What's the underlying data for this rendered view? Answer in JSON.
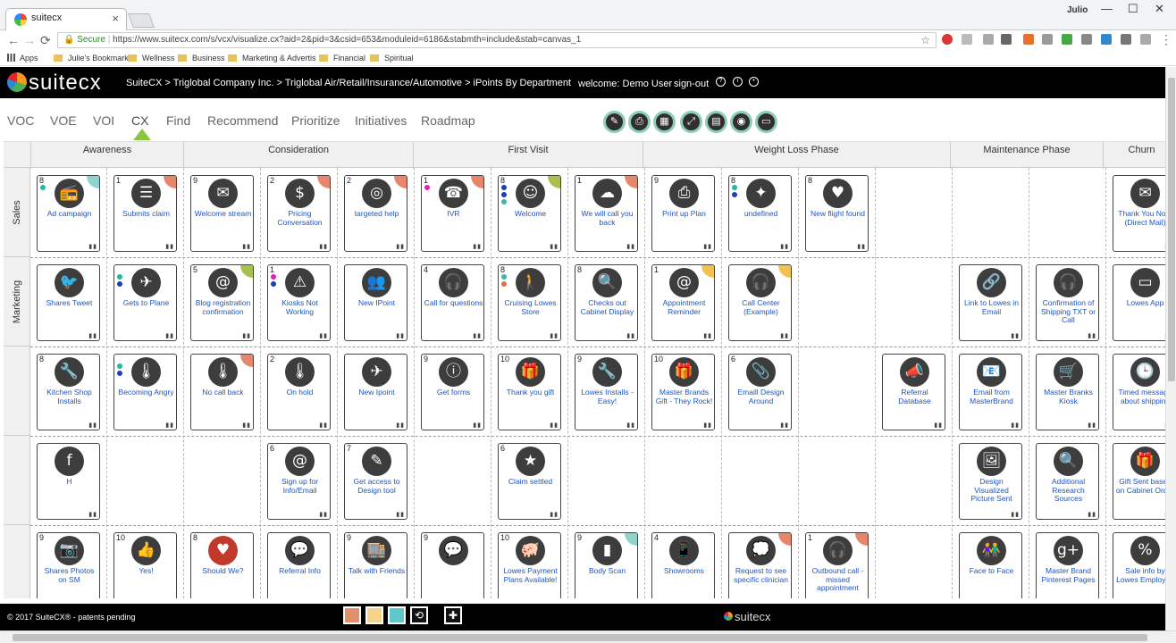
{
  "browser": {
    "tab_title": "suitecx",
    "user": "Julio",
    "address": {
      "secure": "Secure",
      "url": "https://www.suitecx.com/s/vcx/visualize.cx?aid=2&pid=3&csid=653&moduleid=6186&stabmth=include&stab=canvas_1"
    },
    "bookmarks": [
      "Apps",
      "Julie's Bookmarks",
      "Wellness",
      "Business",
      "Marketing & Advertis",
      "Financial",
      "Spiritual"
    ]
  },
  "app": {
    "logo": "suitecx",
    "breadcrumb": "SuiteCX > Triglobal Company Inc. > Triglobal Air/Retail/Insurance/Automotive > iPoints By Department",
    "welcome": "welcome: Demo User",
    "signout": "sign-out"
  },
  "nav": [
    "VOC",
    "VOE",
    "VOI",
    "CX",
    "Find",
    "Recommend",
    "Prioritize",
    "Initiatives",
    "Roadmap"
  ],
  "active_nav": "CX",
  "phases": [
    "Awareness",
    "Consideration",
    "First Visit",
    "Weight Loss Phase",
    "Maintenance Phase",
    "Churn"
  ],
  "rows": [
    "Sales",
    "Marketing",
    "",
    "",
    ""
  ],
  "cards": [
    {
      "num": "8",
      "label": "Ad campaign",
      "icon": "radio-icon",
      "corner": "#8fd3cf",
      "dots": [
        "#22b8a8"
      ],
      "row": 0,
      "col": 0
    },
    {
      "num": "1",
      "label": "Submits claim",
      "icon": "document-icon",
      "corner": "#e8866b",
      "row": 0,
      "col": 1
    },
    {
      "num": "9",
      "label": "Welcome stream",
      "icon": "envelope-open-icon",
      "row": 0,
      "col": 2
    },
    {
      "num": "2",
      "label": "Pricing Conversation",
      "icon": "money-icon",
      "corner": "#e8866b",
      "row": 0,
      "col": 3
    },
    {
      "num": "2",
      "label": "targeted help",
      "icon": "target-icon",
      "corner": "#e8866b",
      "row": 0,
      "col": 4
    },
    {
      "num": "1",
      "label": "IVR",
      "icon": "phone-cycle-icon",
      "corner": "#e8866b",
      "dots": [
        "#e020c0"
      ],
      "row": 0,
      "col": 5
    },
    {
      "num": "8",
      "label": "Welcome",
      "icon": "smiley-icon",
      "corner": "#a8c14c",
      "dots": [
        "#1d3fb8",
        "#1d3fb8",
        "#3db8a8"
      ],
      "row": 0,
      "col": 6
    },
    {
      "num": "1",
      "label": "We will call you back",
      "icon": "cloud-icon",
      "corner": "#e8866b",
      "row": 0,
      "col": 7
    },
    {
      "num": "9",
      "label": "Print up Plan",
      "icon": "pdf-icon",
      "row": 0,
      "col": 8
    },
    {
      "num": "8",
      "label": "undefined",
      "icon": "idea-icon",
      "dots": [
        "#22b8a8",
        "#1d3fb8"
      ],
      "row": 0,
      "col": 9
    },
    {
      "num": "8",
      "label": "New flight found",
      "icon": "heart-icon",
      "row": 0,
      "col": 10
    },
    {
      "num": "",
      "label": "Thank You Note (Direct Mail)",
      "icon": "mail-icon",
      "row": 0,
      "col": 14
    },
    {
      "num": "",
      "label": "Shares Tweet",
      "icon": "twitter-icon",
      "row": 1,
      "col": 0
    },
    {
      "num": "",
      "label": "Gets to Plane",
      "icon": "plane-icon",
      "dots": [
        "#22b8a8",
        "#1d3fb8"
      ],
      "row": 1,
      "col": 1
    },
    {
      "num": "5",
      "label": "Blog registration confirmation",
      "icon": "at-icon",
      "corner": "#a8c14c",
      "row": 1,
      "col": 2
    },
    {
      "num": "1",
      "label": "Kiosks Not Working",
      "icon": "warning-icon",
      "dots": [
        "#e020c0",
        "#1d3fb8"
      ],
      "row": 1,
      "col": 3
    },
    {
      "num": "",
      "label": "New IPoint",
      "icon": "people-icon",
      "row": 1,
      "col": 4
    },
    {
      "num": "4",
      "label": "Call for questions",
      "icon": "headset-icon",
      "row": 1,
      "col": 5
    },
    {
      "num": "8",
      "label": "Cruising Lowes Store",
      "icon": "walking-icon",
      "dots": [
        "#3db8a8",
        "#e86a4a"
      ],
      "row": 1,
      "col": 6
    },
    {
      "num": "8",
      "label": "Checks out Cabinet Display",
      "icon": "magnifier-icon",
      "row": 1,
      "col": 7
    },
    {
      "num": "1",
      "label": "Appointment Reminder",
      "icon": "at-icon",
      "corner": "#f2c14e",
      "row": 1,
      "col": 8
    },
    {
      "num": "",
      "label": "Call Center (Example)",
      "icon": "headset-icon",
      "corner": "#f2c14e",
      "row": 1,
      "col": 9
    },
    {
      "num": "",
      "label": "Link to Lowes in Email",
      "icon": "link-icon",
      "row": 1,
      "col": 12
    },
    {
      "num": "",
      "label": "Confirmation of Shipping TXT or Call",
      "icon": "headset-icon",
      "row": 1,
      "col": 13
    },
    {
      "num": "",
      "label": "Lowes App",
      "icon": "browser-icon",
      "row": 1,
      "col": 14
    },
    {
      "num": "8",
      "label": "Kitchen Shop Installs",
      "icon": "tools-icon",
      "row": 2,
      "col": 0
    },
    {
      "num": "",
      "label": "Becoming Angry",
      "icon": "thermometer-icon",
      "dots": [
        "#22b8a8",
        "#1d3fb8"
      ],
      "row": 2,
      "col": 1
    },
    {
      "num": "",
      "label": "No call back",
      "icon": "thermometer-icon",
      "corner": "#e8866b",
      "row": 2,
      "col": 2
    },
    {
      "num": "2",
      "label": "On hold",
      "icon": "thermometer-icon",
      "row": 2,
      "col": 3
    },
    {
      "num": "",
      "label": "New Ipoint",
      "icon": "plane-icon",
      "row": 2,
      "col": 4
    },
    {
      "num": "9",
      "label": "Get forms",
      "icon": "info-icon",
      "row": 2,
      "col": 5
    },
    {
      "num": "10",
      "label": "Thank you gift",
      "icon": "gift-icon",
      "row": 2,
      "col": 6
    },
    {
      "num": "9",
      "label": "Lowes Installs - Easy!",
      "icon": "tools-icon",
      "row": 2,
      "col": 7
    },
    {
      "num": "10",
      "label": "Master Brands Gift - They Rock!",
      "icon": "gift-icon",
      "row": 2,
      "col": 8
    },
    {
      "num": "6",
      "label": "Emaill Design Around",
      "icon": "paperclip-icon",
      "row": 2,
      "col": 9
    },
    {
      "num": "",
      "label": "Referral Database",
      "icon": "megaphone-icon",
      "row": 2,
      "col": 11
    },
    {
      "num": "",
      "label": "Email from MasterBrand",
      "icon": "email-doc-icon",
      "row": 2,
      "col": 12
    },
    {
      "num": "",
      "label": "Master Branks Kiosk",
      "icon": "cart-icon",
      "row": 2,
      "col": 13
    },
    {
      "num": "",
      "label": "Timed message about shipping",
      "icon": "clock-icon",
      "row": 2,
      "col": 14
    },
    {
      "num": "",
      "label": "H",
      "icon": "facebook-icon",
      "row": 3,
      "col": 0
    },
    {
      "num": "6",
      "label": "Sign up for Info/Email",
      "icon": "at-icon",
      "row": 3,
      "col": 3
    },
    {
      "num": "7",
      "label": "Get access to Design tool",
      "icon": "design-tools-icon",
      "row": 3,
      "col": 4
    },
    {
      "num": "6",
      "label": "Claim settled",
      "icon": "star-icon",
      "row": 3,
      "col": 6
    },
    {
      "num": "",
      "label": "Design Visualized Picture Sent",
      "icon": "picture-icon",
      "row": 3,
      "col": 12
    },
    {
      "num": "",
      "label": "Additional Research Sources",
      "icon": "magnifier-icon",
      "row": 3,
      "col": 13
    },
    {
      "num": "",
      "label": "Gift Sent based on Cabinet Order",
      "icon": "gift-icon",
      "row": 3,
      "col": 14
    },
    {
      "num": "9",
      "label": "Shares Photos on SM",
      "icon": "photo-icon",
      "row": 4,
      "col": 0
    },
    {
      "num": "10",
      "label": "Yes!",
      "icon": "thumbs-up-icon",
      "row": 4,
      "col": 1
    },
    {
      "num": "8",
      "label": "Should We?",
      "icon": "heart-icon",
      "red": true,
      "row": 4,
      "col": 2
    },
    {
      "num": "",
      "label": "Referral Info",
      "icon": "chat-person-icon",
      "row": 4,
      "col": 3
    },
    {
      "num": "9",
      "label": "Talk with Friends",
      "icon": "store-icon",
      "row": 4,
      "col": 4
    },
    {
      "num": "9",
      "label": "",
      "icon": "chat-person-icon",
      "row": 4,
      "col": 5
    },
    {
      "num": "10",
      "label": "Lowes Payment Plans Available!",
      "icon": "piggy-bank-icon",
      "row": 4,
      "col": 6
    },
    {
      "num": "9",
      "label": "Body Scan",
      "icon": "bar-chart-icon",
      "corner": "#8fd3cf",
      "row": 4,
      "col": 7
    },
    {
      "num": "4",
      "label": "Showrooms",
      "icon": "smartphone-icon",
      "row": 4,
      "col": 8
    },
    {
      "num": "",
      "label": "Request to see specific clinician",
      "icon": "chat-bubbles-icon",
      "corner": "#e8866b",
      "row": 4,
      "col": 9
    },
    {
      "num": "1",
      "label": "Outbound call - missed appointment",
      "icon": "headset-icon",
      "corner": "#e8866b",
      "row": 4,
      "col": 10
    },
    {
      "num": "",
      "label": "Face to Face",
      "icon": "face-to-face-icon",
      "row": 4,
      "col": 12
    },
    {
      "num": "",
      "label": "Master Brand Pinterest Pages",
      "icon": "google-plus-icon",
      "row": 4,
      "col": 13
    },
    {
      "num": "",
      "label": "Sale info by Lowes Employee",
      "icon": "sale-tag-icon",
      "row": 4,
      "col": 14
    }
  ],
  "footer": {
    "copyright": "© 2017 SuiteCX® - patents pending",
    "logo": "suitecx",
    "swatches": [
      "#e0906a",
      "#f4d38a",
      "#5fc6cc"
    ]
  }
}
